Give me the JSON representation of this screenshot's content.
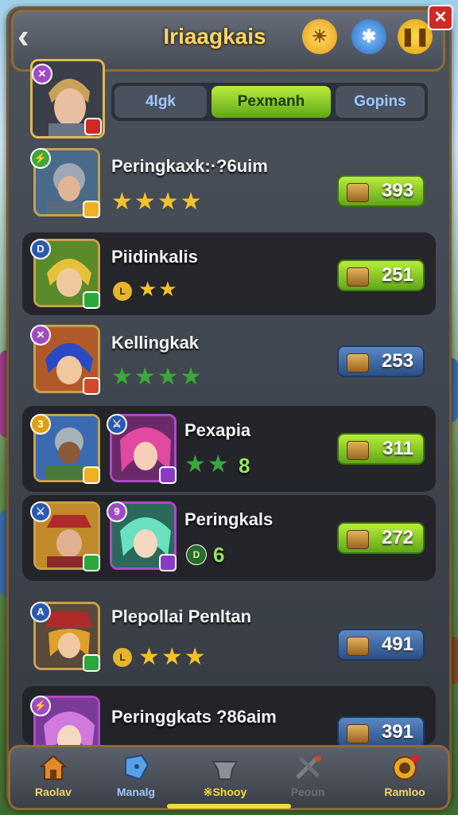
{
  "header": {
    "title": "Iriaagkais"
  },
  "tabs": [
    {
      "label": "4lgk",
      "active": false
    },
    {
      "label": "Pexmanh",
      "active": true
    },
    {
      "label": "Gopins",
      "active": false
    }
  ],
  "rows": [
    {
      "name": "Peringkaxk:·?6uim",
      "stars": "★★★★",
      "price": "393",
      "price_style": "green"
    },
    {
      "name": "Piidinkalis",
      "level": "L",
      "stars": "★★",
      "price": "251",
      "price_style": "green"
    },
    {
      "name": "Kellingkak",
      "stars": "★★★★",
      "price": "253",
      "price_style": "blue"
    },
    {
      "name": "Pexapia",
      "stars": "★★",
      "count": "8",
      "price": "311",
      "price_style": "green"
    },
    {
      "name": "Peringkals",
      "level": "D",
      "count": "6",
      "price": "272",
      "price_style": "green"
    },
    {
      "name": "Plepollai Penltan",
      "level": "L",
      "stars": "★★★",
      "price": "491",
      "price_style": "blue"
    },
    {
      "name": "Peringgkats ?86aim",
      "price": "391",
      "price_style": "blue"
    }
  ],
  "nav": [
    {
      "label": "Raolav",
      "icon": "home-icon"
    },
    {
      "label": "Manalg",
      "icon": "shield-icon"
    },
    {
      "label": "※Shooy",
      "icon": "anvil-icon",
      "active": true
    },
    {
      "label": "Peoun",
      "icon": "swords-icon"
    },
    {
      "label": "Ramloo",
      "icon": "pouch-icon"
    }
  ],
  "colors": {
    "accent_green": "#7fcc22",
    "accent_blue": "#3a6aa8",
    "gold": "#f6d66a"
  }
}
